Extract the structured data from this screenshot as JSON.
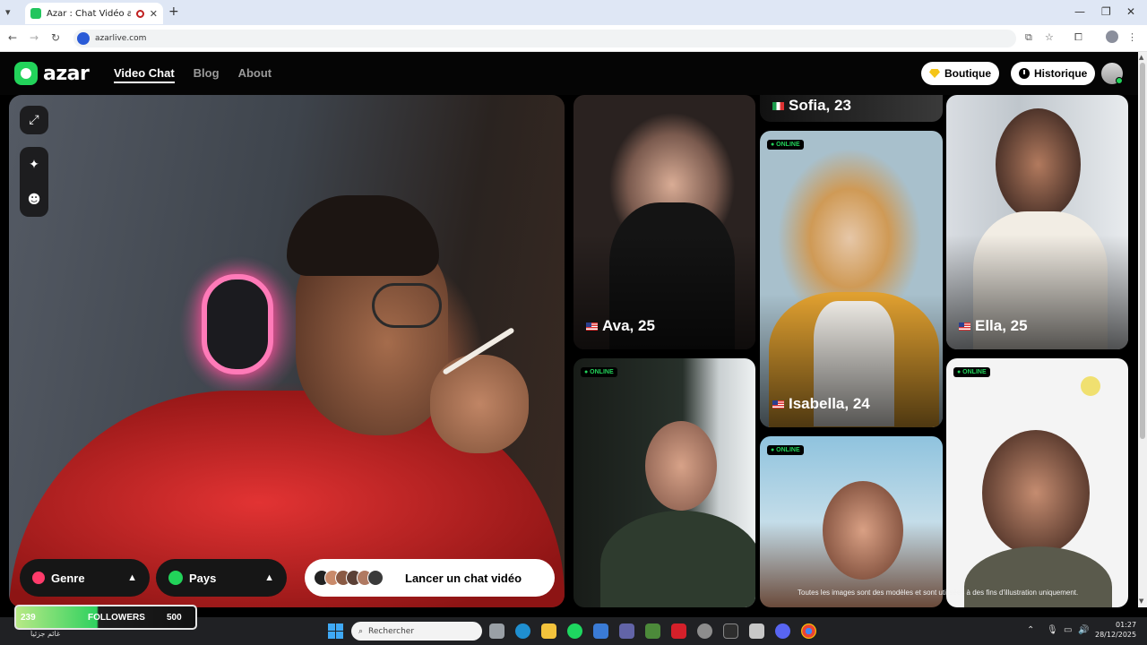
{
  "browser": {
    "tab_title": "Azar : Chat Vidéo avec de",
    "tab_close": "✕",
    "new_tab": "+",
    "url": "azarlive.com"
  },
  "header": {
    "logo": "azar",
    "nav": [
      "Video Chat",
      "Blog",
      "About"
    ],
    "boutique": "Boutique",
    "historique": "Historique"
  },
  "controls": {
    "genre": "Genre",
    "pays": "Pays",
    "launch": "Lancer un chat vidéo"
  },
  "gallery": {
    "online_label": "● ONLINE",
    "cards": [
      {
        "name": "Ava, 25",
        "flag": "us"
      },
      {
        "name": "Sofia, 23",
        "flag": "it"
      },
      {
        "name": "Isabella, 24",
        "flag": "us"
      },
      {
        "name": "Ella, 25",
        "flag": "us"
      }
    ],
    "disclaimer": "Toutes les images sont des modèles et sont utilisées à des fins d'illustration uniquement."
  },
  "overlay": {
    "followers_count": "239",
    "followers_label": "FOLLOWERS",
    "followers_goal": "500"
  },
  "taskbar": {
    "weather": "غائم جزئياً",
    "search_placeholder": "Rechercher",
    "time": "01:27",
    "date": "28/12/2025"
  }
}
